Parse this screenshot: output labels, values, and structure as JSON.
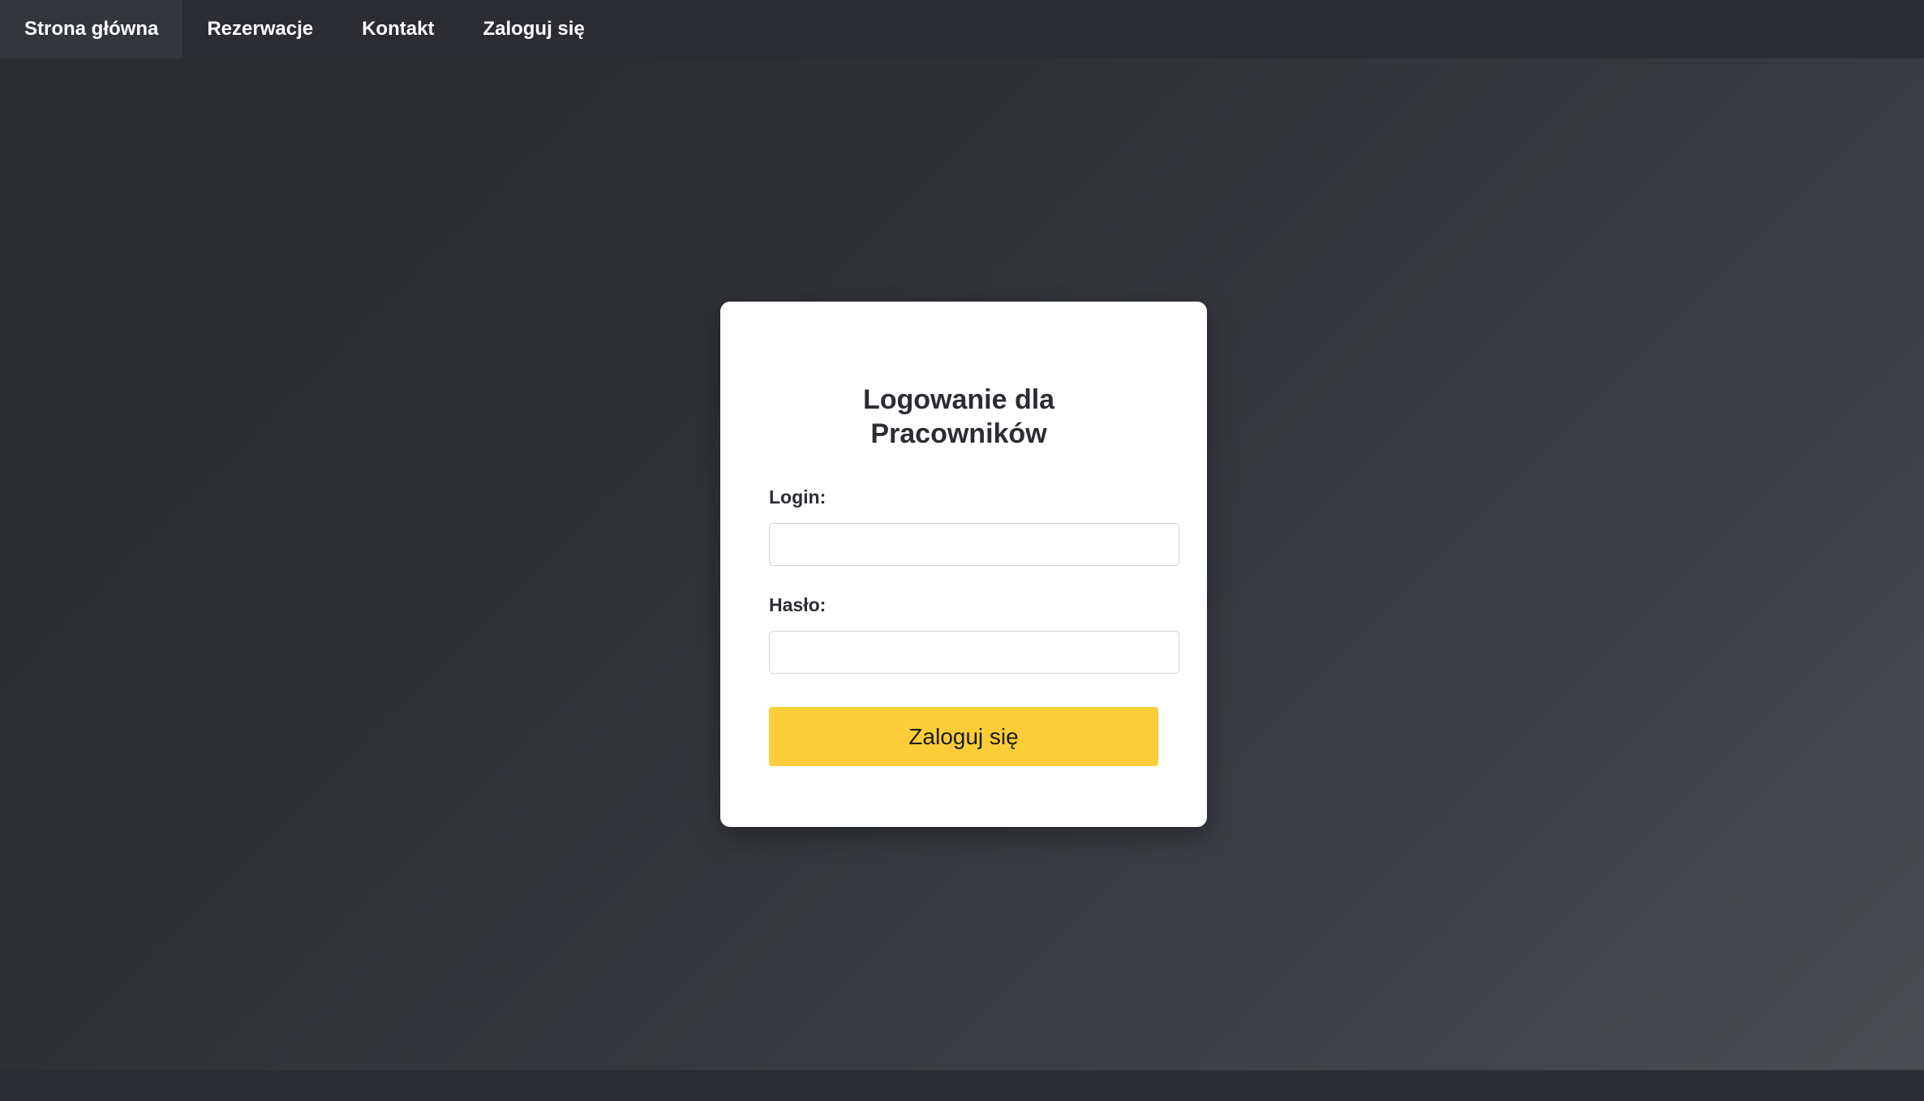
{
  "nav": {
    "items": [
      {
        "label": "Strona główna",
        "active": true
      },
      {
        "label": "Rezerwacje",
        "active": false
      },
      {
        "label": "Kontakt",
        "active": false
      },
      {
        "label": "Zaloguj się",
        "active": false
      }
    ]
  },
  "login_form": {
    "title_line1": "Logowanie dla",
    "title_line2": "Pracowników",
    "login_label": "Login:",
    "login_value": "",
    "password_label": "Hasło:",
    "password_value": "",
    "submit_label": "Zaloguj się"
  },
  "colors": {
    "accent": "#fccd38",
    "navbar": "#2b2d32",
    "card": "#ffffff",
    "text_dark": "#2b2d32"
  }
}
